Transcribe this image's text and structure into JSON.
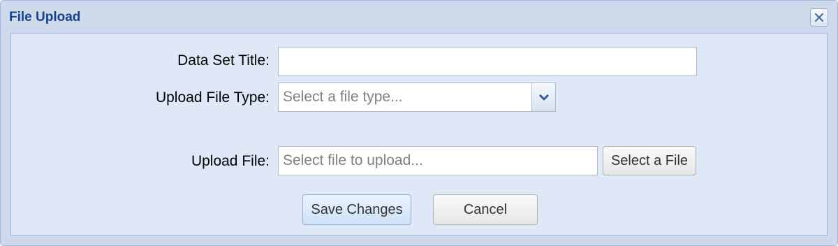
{
  "dialog": {
    "title": "File Upload",
    "close_icon": "close-x-icon"
  },
  "form": {
    "data_set_title": {
      "label": "Data Set Title:",
      "value": ""
    },
    "upload_file_type": {
      "label": "Upload File Type:",
      "placeholder": "Select a file type...",
      "trigger_icon": "chevron-down-icon"
    },
    "upload_file": {
      "label": "Upload File:",
      "placeholder": "Select file to upload...",
      "select_button_label": "Select a File"
    }
  },
  "actions": {
    "save_label": "Save Changes",
    "cancel_label": "Cancel"
  },
  "colors": {
    "title": "#15428b",
    "window_bg": "#cedaea",
    "panel_bg": "#dfe8f6",
    "border": "#99bbe8"
  }
}
